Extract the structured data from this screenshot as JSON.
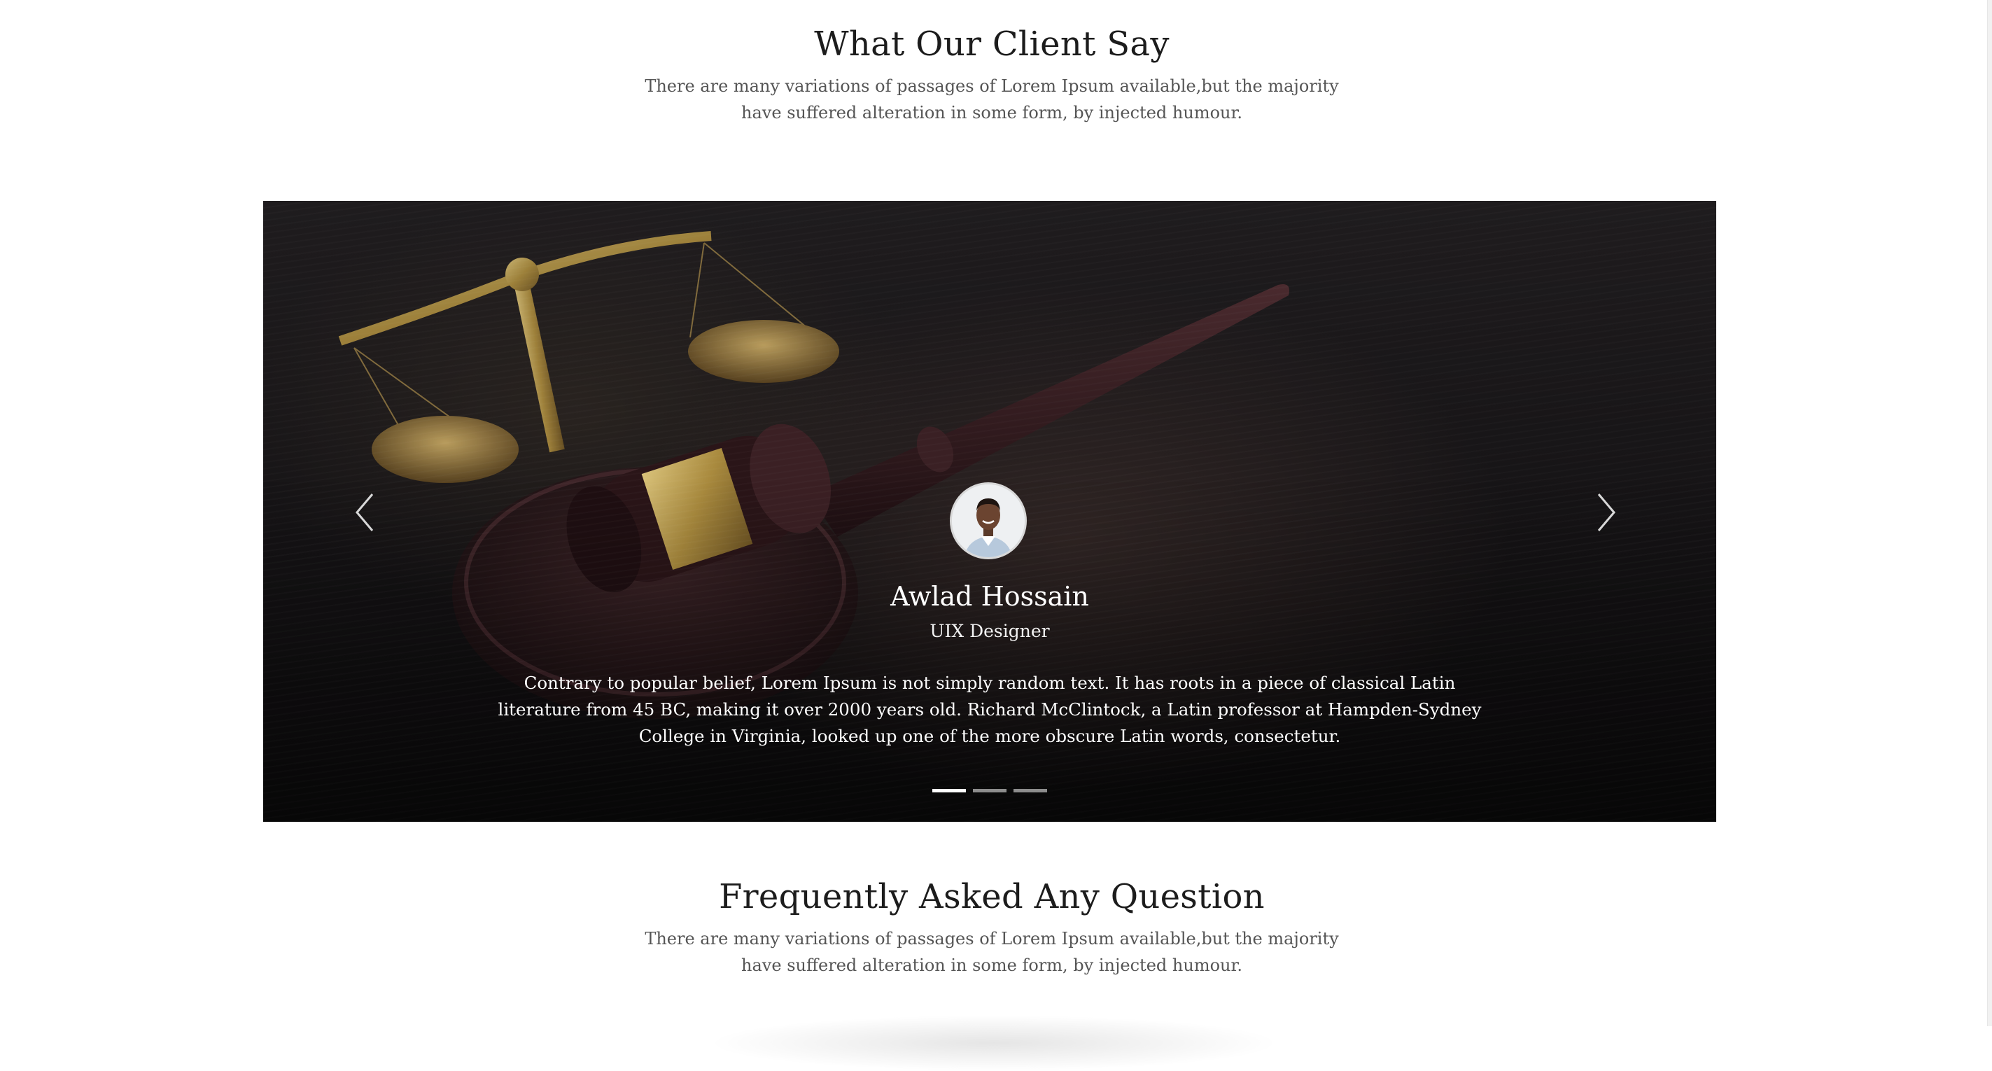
{
  "testimonials": {
    "title": "What Our Client Say",
    "subtitle": "There are many variations of passages of Lorem Ipsum available,but the majority have suffered alteration in some form, by injected humour."
  },
  "slider": {
    "background": "judge-gavel-and-scales-photo",
    "prev_icon": "chevron-left-icon",
    "next_icon": "chevron-right-icon",
    "active_slide": 1,
    "slide_count": 3,
    "slide": {
      "name": "Awlad Hossain",
      "role": "UIX Designer",
      "quote": "Contrary to popular belief, Lorem Ipsum is not simply random text. It has roots in a piece of classical Latin literature from 45 BC, making it over 2000 years old. Richard McClintock, a Latin professor at Hampden-Sydney College in Virginia, looked up one of the more obscure Latin words, consectetur."
    }
  },
  "faq": {
    "title": "Frequently Asked Any Question",
    "subtitle": "There are many variations of passages of Lorem Ipsum available,but the majority have suffered alteration in some form, by injected humour."
  },
  "colors": {
    "heading": "#1c1c1c",
    "body_text": "#555555",
    "slider_text": "#ffffff",
    "dot_inactive": "#8d8d8d",
    "dot_active": "#ffffff"
  }
}
